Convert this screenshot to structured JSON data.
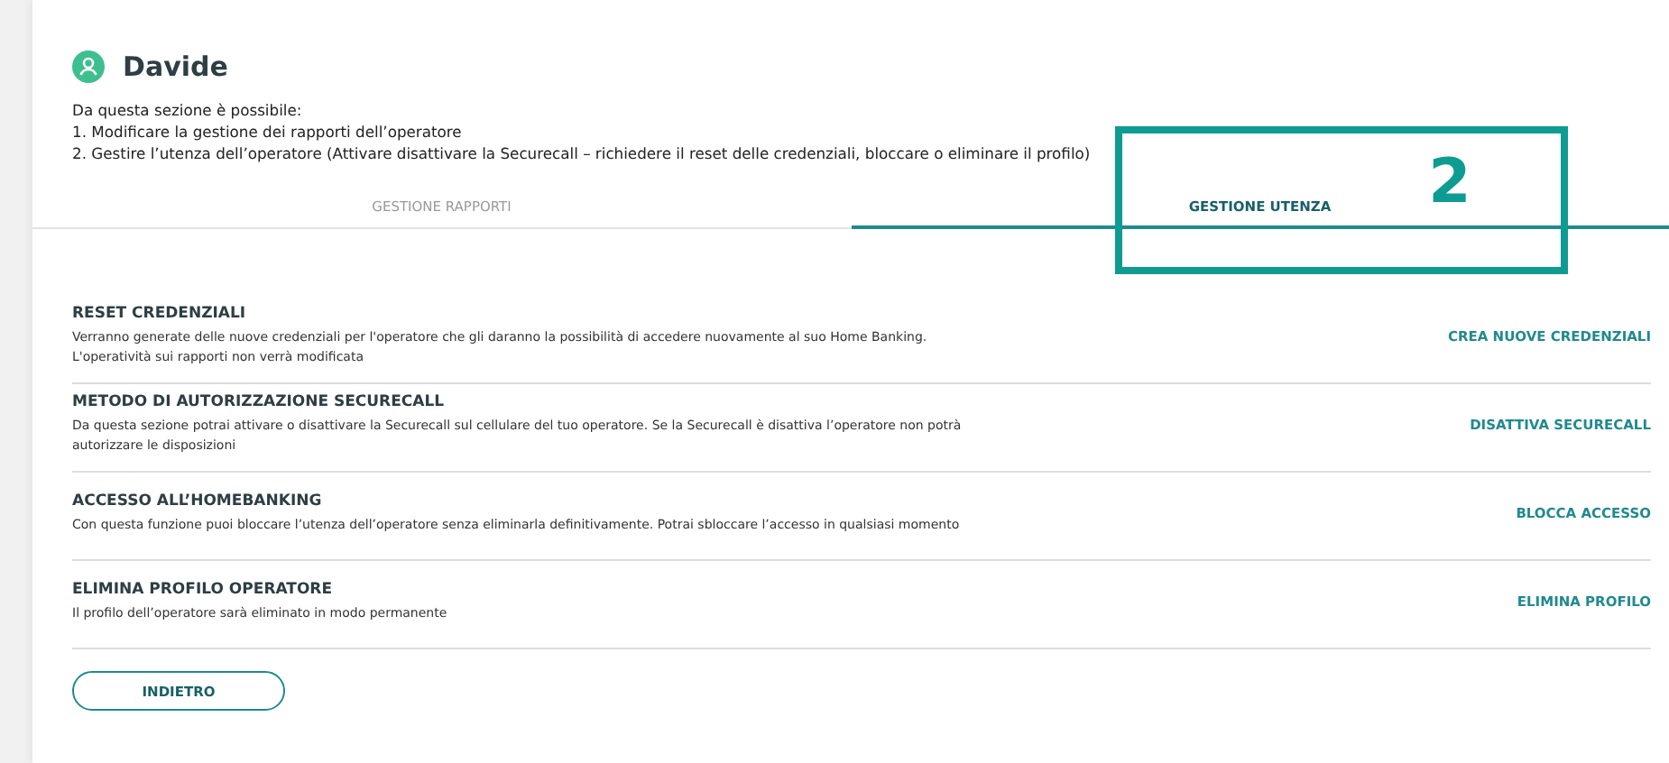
{
  "header": {
    "name": "Davide",
    "intro": [
      "Da questa sezione è possibile:",
      "1. Modificare la gestione dei rapporti dell’operatore",
      "2. Gestire l’utenza dell’operatore (Attivare disattivare la Securecall – richiedere il reset delle credenziali, bloccare o eliminare il profilo)"
    ]
  },
  "tabs": [
    {
      "label": "GESTIONE RAPPORTI",
      "selected": false
    },
    {
      "label": "GESTIONE UTENZA",
      "selected": true
    }
  ],
  "annotation": {
    "label": "2"
  },
  "sections": [
    {
      "title": "RESET CREDENZIALI",
      "description": [
        "Verranno generate delle nuove credenziali per l'operatore che gli daranno la possibilità di accedere nuovamente al suo Home Banking.",
        "L'operatività sui rapporti non verrà modificata"
      ],
      "action": "CREA NUOVE CREDENZIALI"
    },
    {
      "title": "METODO DI AUTORIZZAZIONE SECURECALL",
      "description": [
        "Da questa sezione potrai attivare o disattivare la Securecall sul cellulare del tuo operatore. Se la Securecall è disattiva l’operatore non potrà",
        "autorizzare le disposizioni"
      ],
      "action": "DISATTIVA SECURECALL"
    },
    {
      "title": "ACCESSO ALL’HOMEBANKING",
      "description": [
        "Con questa funzione puoi bloccare l’utenza dell’operatore senza eliminarla definitivamente. Potrai sbloccare l’accesso in qualsiasi momento"
      ],
      "action": "BLOCCA ACCESSO"
    },
    {
      "title": "ELIMINA PROFILO OPERATORE",
      "description": [
        "Il profilo dell’operatore sarà eliminato in modo permanente"
      ],
      "action": "ELIMINA PROFILO"
    }
  ],
  "back_button": "INDIETRO"
}
